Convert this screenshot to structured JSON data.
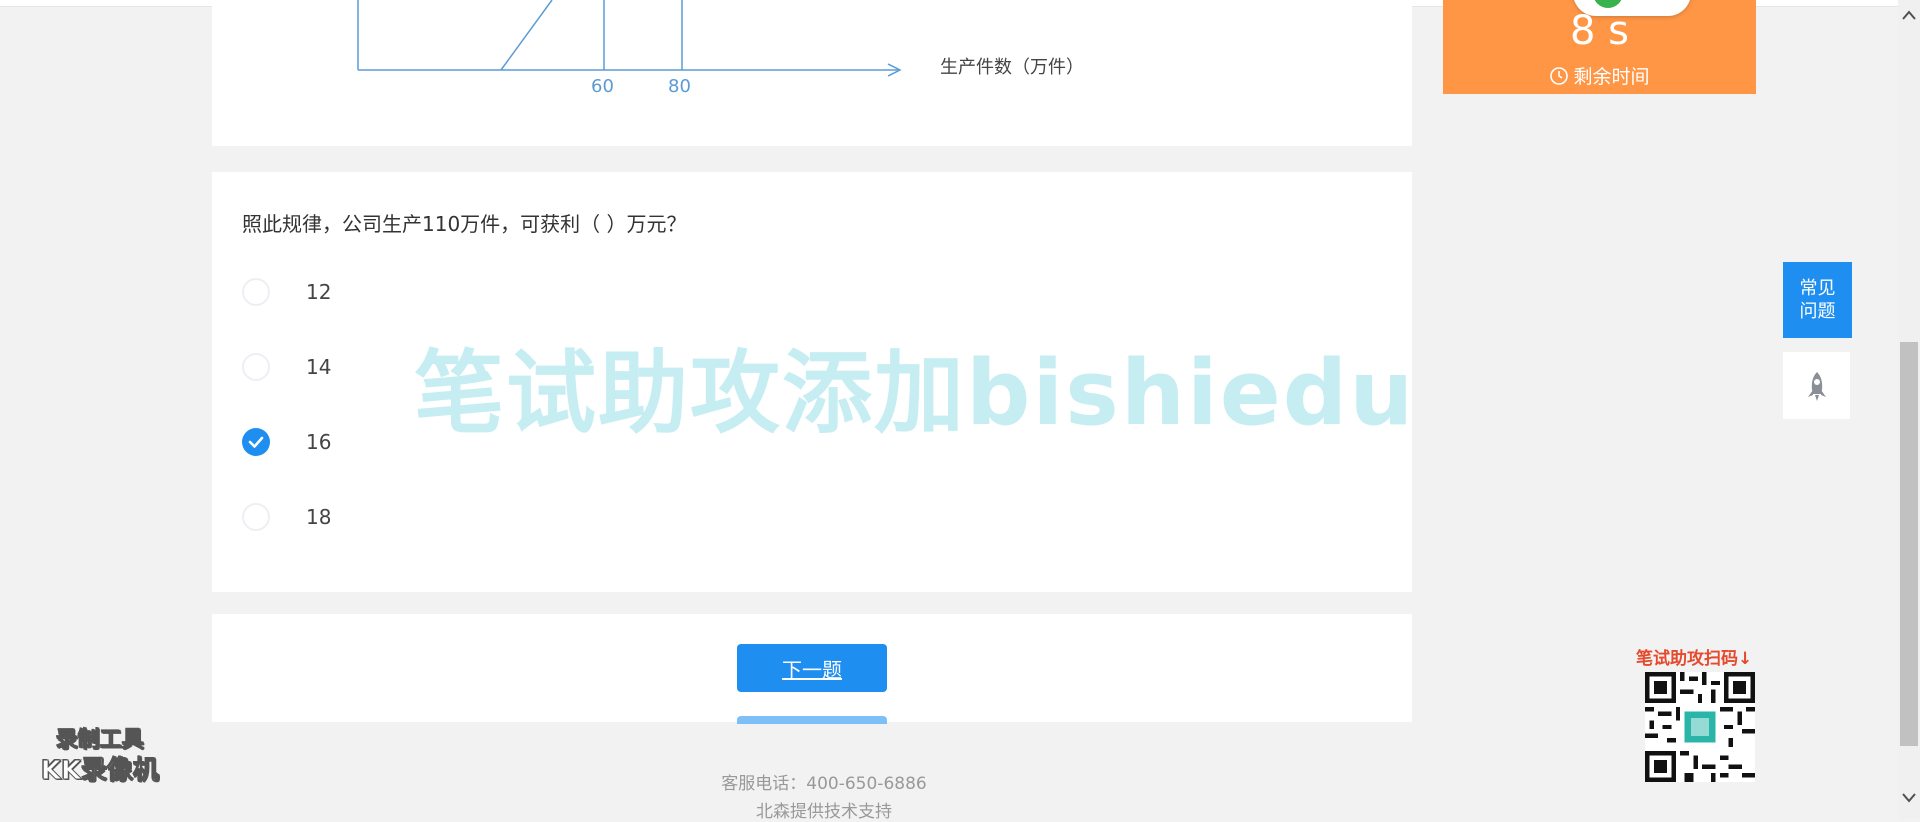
{
  "chart": {
    "xlabel": "生产件数（万件）",
    "ticks": [
      "60",
      "80"
    ]
  },
  "question": {
    "text": "照此规律，公司生产110万件，可获利（ ）万元？",
    "options": [
      {
        "label": "12",
        "selected": false
      },
      {
        "label": "14",
        "selected": false
      },
      {
        "label": "16",
        "selected": true
      },
      {
        "label": "18",
        "selected": false
      }
    ]
  },
  "nav": {
    "next_label": "下一题"
  },
  "timer": {
    "value": "8 s",
    "label": "剩余时间"
  },
  "faq": {
    "label": "常见问题"
  },
  "icons": {
    "clock": "clock-icon",
    "rocket": "rocket-icon",
    "check": "check-icon"
  },
  "watermark": {
    "text": "笔试助攻添加bishiedu"
  },
  "qr": {
    "title": "笔试助攻扫码↓"
  },
  "footer": {
    "phone": "客服电话：400-650-6886",
    "support": "北森提供技术支持"
  },
  "recorder": {
    "line1": "录制工具",
    "line2": "KK录像机"
  },
  "colors": {
    "accent": "#1e8ff0",
    "timer": "#ff9646",
    "watermark": "#78d7e1",
    "qr_title": "#e64a2e"
  }
}
